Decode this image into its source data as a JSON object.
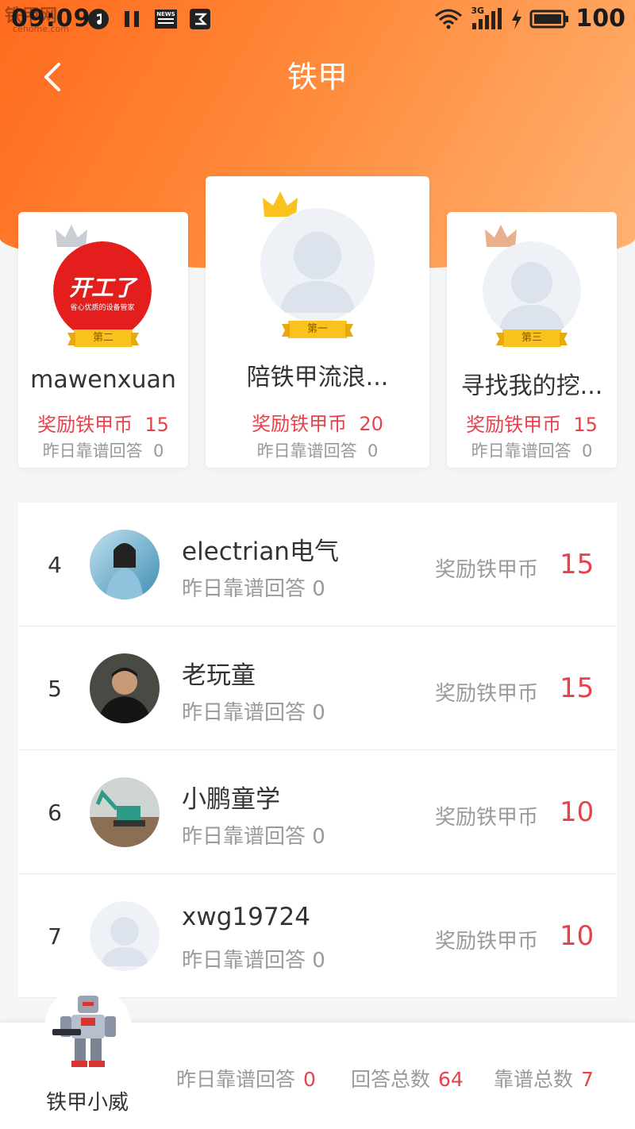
{
  "status_bar": {
    "time": "09:09",
    "watermark": "铁甲网",
    "watermark_sub": "cehome.com",
    "news_icon_text": "NEWS",
    "network": "3G",
    "battery": "100"
  },
  "nav": {
    "title": "铁甲"
  },
  "podium": [
    {
      "rank_label": "第二",
      "name": "mawenxuan",
      "reward_label": "奖励铁甲币",
      "reward_value": "15",
      "reliable_label": "昨日靠谱回答",
      "reliable_value": "0",
      "crown_color": "#c9cdd4",
      "logo_title": "开工了",
      "logo_sub": "省心优质的设备管家"
    },
    {
      "rank_label": "第一",
      "name": "陪铁甲流浪...",
      "reward_label": "奖励铁甲币",
      "reward_value": "20",
      "reliable_label": "昨日靠谱回答",
      "reliable_value": "0",
      "crown_color": "#f9c21c"
    },
    {
      "rank_label": "第三",
      "name": "寻找我的挖...",
      "reward_label": "奖励铁甲币",
      "reward_value": "15",
      "reliable_label": "昨日靠谱回答",
      "reliable_value": "0",
      "crown_color": "#e8b08c"
    }
  ],
  "list": [
    {
      "rank": "4",
      "name": "electrian电气",
      "sub": "昨日靠谱回答  0",
      "reward_label": "奖励铁甲币",
      "reward_value": "15"
    },
    {
      "rank": "5",
      "name": "老玩童",
      "sub": "昨日靠谱回答  0",
      "reward_label": "奖励铁甲币",
      "reward_value": "15"
    },
    {
      "rank": "6",
      "name": "小鹏童学",
      "sub": "昨日靠谱回答  0",
      "reward_label": "奖励铁甲币",
      "reward_value": "10"
    },
    {
      "rank": "7",
      "name": "xwg19724",
      "sub": "昨日靠谱回答  0",
      "reward_label": "奖励铁甲币",
      "reward_value": "10"
    }
  ],
  "me": {
    "name": "铁甲小威",
    "stats": [
      {
        "label": "昨日靠谱回答",
        "value": "0"
      },
      {
        "label": "回答总数",
        "value": "64"
      },
      {
        "label": "靠谱总数",
        "value": "7"
      }
    ]
  },
  "colors": {
    "accent_red": "#e8414b",
    "header_orange": "#ff6a1e"
  }
}
